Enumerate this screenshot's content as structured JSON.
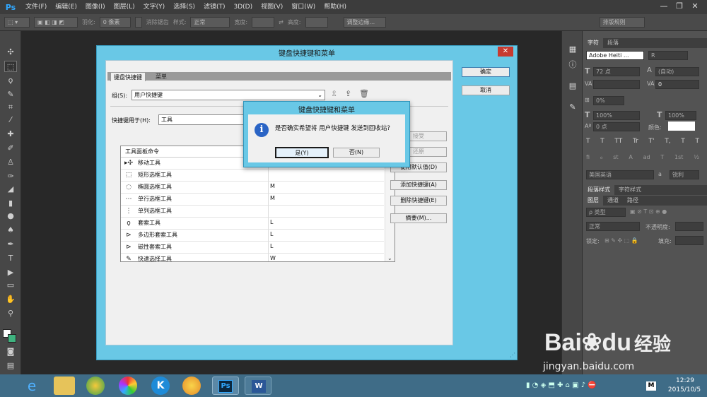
{
  "app": {
    "logo": "Ps",
    "menu": [
      "文件(F)",
      "编辑(E)",
      "图像(I)",
      "图层(L)",
      "文字(Y)",
      "选择(S)",
      "滤镜(T)",
      "3D(D)",
      "视图(V)",
      "窗口(W)",
      "帮助(H)"
    ]
  },
  "window_controls": {
    "minimize": "—",
    "restore": "❐",
    "close": "✕"
  },
  "options_bar": {
    "feather_label": "羽化:",
    "feather_value": "0 像素",
    "antialias_label": "消除锯齿",
    "style_label": "样式:",
    "style_value": "正常",
    "width_label": "宽度:",
    "height_label": "高度:",
    "refine_button": "调整边缘...",
    "workspace": "排版规则"
  },
  "char_panel": {
    "tabs": [
      "字符",
      "段落"
    ],
    "font": "Adobe Heiti ...",
    "font_style": "R",
    "size": "72 点",
    "leading": "(自动)",
    "kerning_value": "0",
    "tracking": "0%",
    "vscale": "100%",
    "hscale": "100%",
    "baseline": "0 点",
    "color_label": "颜色:",
    "type_styles": [
      "T",
      "T",
      "TT",
      "Tr",
      "T'",
      "T,",
      "T",
      "T"
    ],
    "opentype": [
      "fi",
      "ℴ",
      "st",
      "A",
      "ad",
      "T",
      "1st",
      "½"
    ],
    "language": "美国英语",
    "aa_label": "a",
    "aa_value": "锐利"
  },
  "styles_tabs": [
    "段落样式",
    "字符样式"
  ],
  "layers_panel": {
    "tabs": [
      "图层",
      "通道",
      "路径"
    ],
    "filter": "ρ 类型",
    "blend": "正常",
    "opacity_label": "不透明度:",
    "lock_label": "锁定:",
    "fill_label": "填充:"
  },
  "keyboard_dialog": {
    "title": "键盘快捷键和菜单",
    "close": "✕",
    "tabs": [
      "键盘快捷键",
      "菜单"
    ],
    "set_label": "组(S):",
    "set_value": "用户快捷键",
    "for_label": "快捷键用于(H):",
    "for_value": "工具",
    "list_header": "工具面板命令",
    "tools": [
      {
        "icon": "▸✣",
        "name": "移动工具",
        "key": ""
      },
      {
        "icon": "⬚",
        "name": "矩形选框工具",
        "key": ""
      },
      {
        "icon": "◌",
        "name": "椭圆选框工具",
        "key": "M"
      },
      {
        "icon": "⋯",
        "name": "单行选框工具",
        "key": "M"
      },
      {
        "icon": "⋮",
        "name": "单列选框工具",
        "key": ""
      },
      {
        "icon": "ϙ",
        "name": "套索工具",
        "key": "L"
      },
      {
        "icon": "⊳",
        "name": "多边形套索工具",
        "key": "L"
      },
      {
        "icon": "⊳",
        "name": "磁性套索工具",
        "key": "L"
      },
      {
        "icon": "✎",
        "name": "快速选择工具",
        "key": "W"
      }
    ],
    "buttons": {
      "ok": "确定",
      "cancel": "取消",
      "accept": "接受",
      "undo": "还原",
      "use_default": "使用默认值(D)",
      "add_shortcut": "添加快捷键(A)",
      "delete_shortcut": "删除快捷键(E)",
      "summary": "摘要(M)..."
    }
  },
  "confirm_dialog": {
    "title": "键盘快捷键和菜单",
    "message": "是否确实希望将 用户快捷键 发送到回收站?",
    "yes": "是(Y)",
    "no": "否(N)"
  },
  "taskbar": {
    "time": "12:29",
    "date": "2015/10/5",
    "ps_label": "Ps",
    "ime": "M"
  },
  "watermark": {
    "brand": "Bai",
    "brand2": "du",
    "cn": "经验",
    "url": "jingyan.baidu.com"
  },
  "colors": {
    "dialog_frame": "#69c8e6",
    "ps_blue": "#31a8ff",
    "taskbar": "#3f6c87",
    "close_red": "#c73a30",
    "info_blue": "#2a64c5"
  }
}
